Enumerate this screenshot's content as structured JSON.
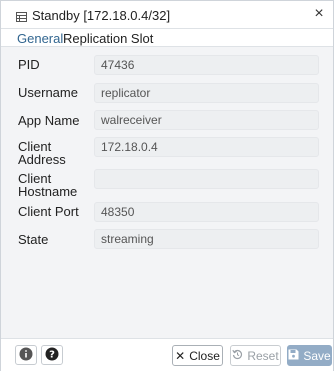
{
  "dialog": {
    "title": "Standby [172.18.0.4/32]",
    "close_glyph": "×"
  },
  "tabs": [
    {
      "label": "General",
      "active": true
    },
    {
      "label": "Replication Slot",
      "active": false
    }
  ],
  "fields": [
    {
      "label": "PID",
      "value": "47436"
    },
    {
      "label": "Username",
      "value": "replicator"
    },
    {
      "label": "App Name",
      "value": "walreceiver"
    },
    {
      "label": "Client Address",
      "value": "172.18.0.4"
    },
    {
      "label": "Client Hostname",
      "value": ""
    },
    {
      "label": "Client Port",
      "value": "48350"
    },
    {
      "label": "State",
      "value": "streaming"
    }
  ],
  "footer": {
    "info_icon": "info-icon",
    "help_icon": "help-icon",
    "close_label": "Close",
    "reset_label": "Reset",
    "save_label": "Save",
    "accent": "#326690",
    "save_bg": "#93acc6"
  }
}
